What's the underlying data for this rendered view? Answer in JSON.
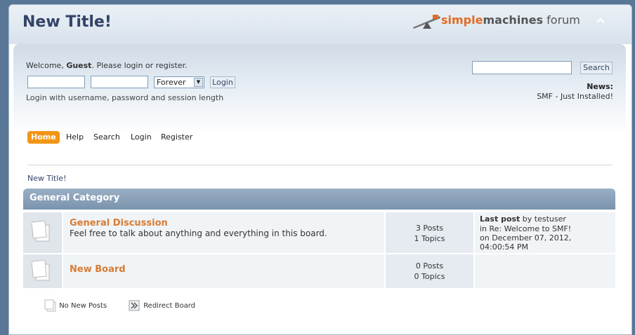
{
  "header": {
    "forum_title": "New Title!",
    "logo_part1": "simple",
    "logo_part2": "machines",
    "logo_part3": " forum"
  },
  "user_panel": {
    "welcome_prefix": "Welcome, ",
    "guest_name": "Guest",
    "welcome_suffix": ". Please login or register.",
    "username_value": "",
    "password_value": "",
    "session_length_selected": "Forever",
    "login_button": "Login",
    "login_hint": "Login with username, password and session length"
  },
  "search": {
    "input_value": "",
    "button_label": "Search"
  },
  "news": {
    "label": "News:",
    "text": "SMF - Just Installed!"
  },
  "menu": {
    "items": [
      "Home",
      "Help",
      "Search",
      "Login",
      "Register"
    ],
    "active": "Home"
  },
  "breadcrumb": "New Title!",
  "category": {
    "name": "General Category",
    "boards": [
      {
        "name": "General Discussion",
        "description": "Feel free to talk about anything and everything in this board.",
        "posts": "3 Posts",
        "topics": "1 Topics",
        "last_post_label": "Last post",
        "last_post_by": " by testuser",
        "last_post_in": "in Re: Welcome to SMF!",
        "last_post_date1": "on December 07, 2012,",
        "last_post_date2": "04:00:54 PM"
      },
      {
        "name": "New Board",
        "description": "",
        "posts": "0 Posts",
        "topics": "0 Topics"
      }
    ]
  },
  "legend": {
    "no_new_posts": "No New Posts",
    "redirect_board": "Redirect Board"
  }
}
